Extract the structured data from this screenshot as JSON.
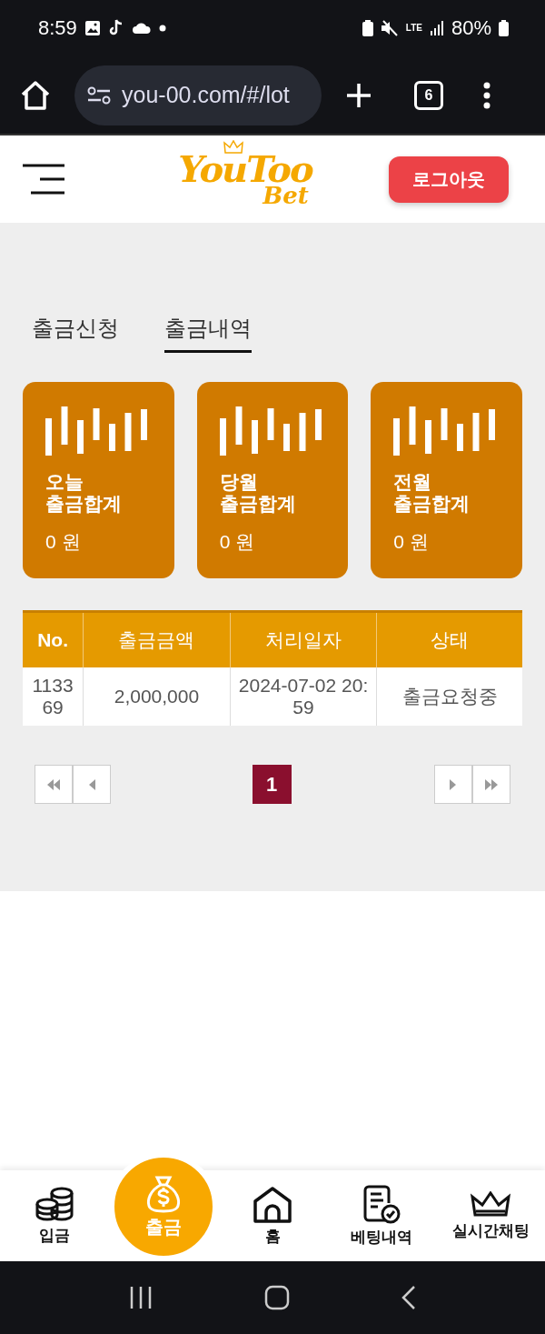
{
  "status_bar": {
    "time": "8:59",
    "network": "LTE",
    "battery": "80%"
  },
  "browser": {
    "url": "you-00.com/#/lot",
    "tab_count": "6"
  },
  "header": {
    "logo": "YouToo",
    "logo_sub": "Bet",
    "logout": "로그아웃"
  },
  "tabs": [
    {
      "label": "출금신청",
      "selected": false
    },
    {
      "label": "출금내역",
      "selected": true
    }
  ],
  "summary_cards": [
    {
      "period": "오늘",
      "label": "출금합계",
      "amount": "0 원"
    },
    {
      "period": "당월",
      "label": "출금합계",
      "amount": "0 원"
    },
    {
      "period": "전월",
      "label": "출금합계",
      "amount": "0 원"
    }
  ],
  "table": {
    "columns": [
      "No.",
      "출금금액",
      "처리일자",
      "상태"
    ],
    "rows": [
      [
        "113369",
        "2,000,000",
        "2024-07-02 20:59",
        "출금요청중"
      ]
    ]
  },
  "pagination": {
    "pages": [
      {
        "label": "1",
        "selected": true
      }
    ]
  },
  "bottom_nav": [
    {
      "label": "입금",
      "kind": "coins",
      "selected": false
    },
    {
      "label": "출금",
      "kind": "moneybag",
      "selected": true
    },
    {
      "label": "홈",
      "kind": "home",
      "selected": false
    },
    {
      "label": "베팅내역",
      "kind": "receipt",
      "selected": false
    },
    {
      "label": "실시간채팅",
      "kind": "crown",
      "selected": false
    }
  ]
}
